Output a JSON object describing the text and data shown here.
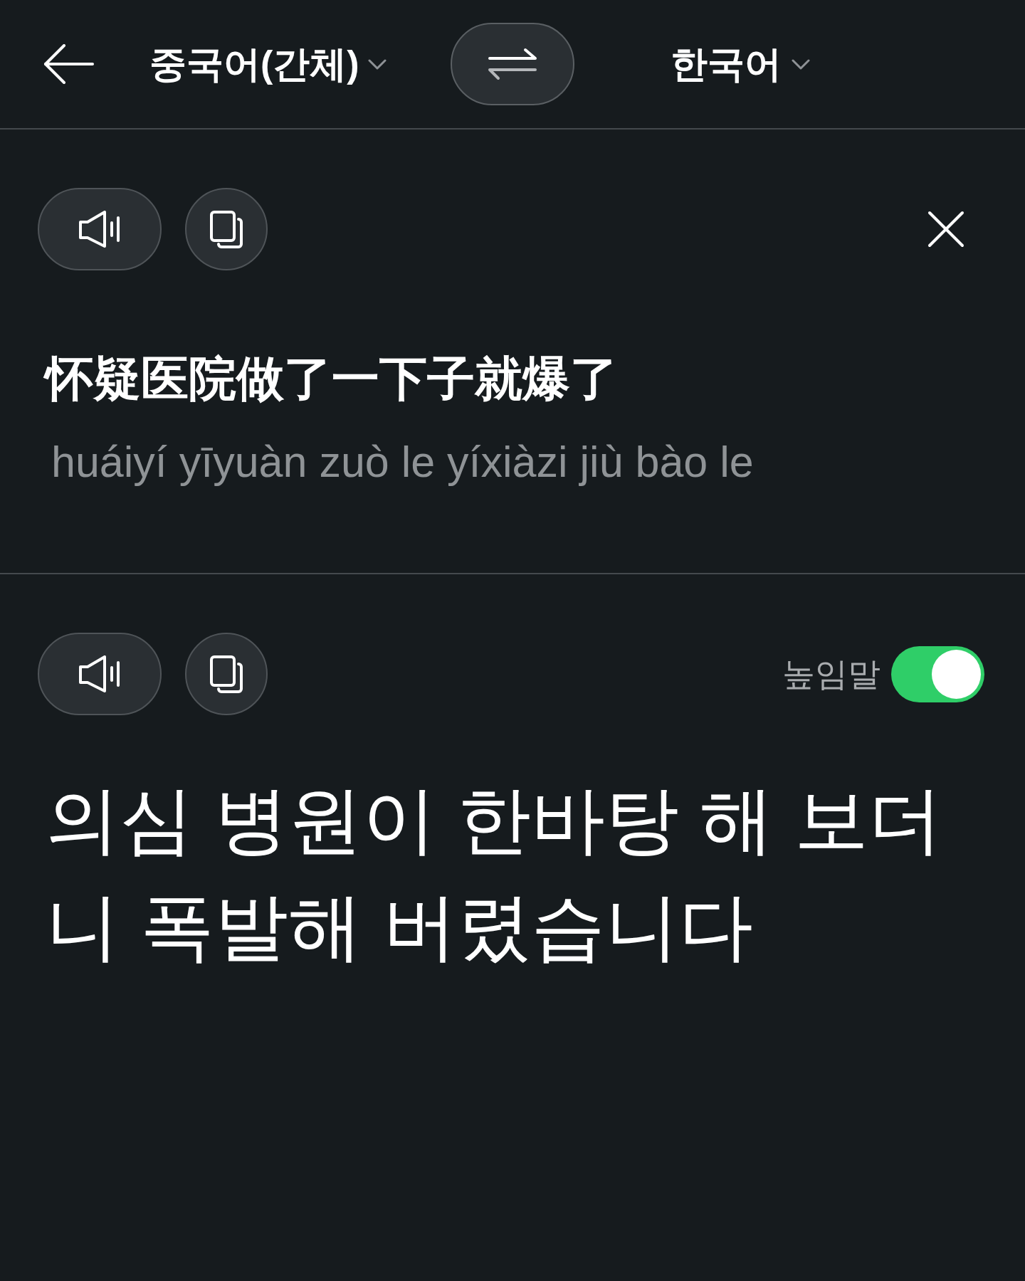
{
  "header": {
    "source_language": "중국어(간체)",
    "target_language": "한국어"
  },
  "source": {
    "text": "怀疑医院做了一下子就爆了",
    "pinyin": "huáiyí yīyuàn zuò le yíxiàzi jiù bào le"
  },
  "target": {
    "honorific": {
      "label": "높임말",
      "on": true
    },
    "text": "의심 병원이 한바탕 해 보더니 폭발해 버렸습니다"
  }
}
